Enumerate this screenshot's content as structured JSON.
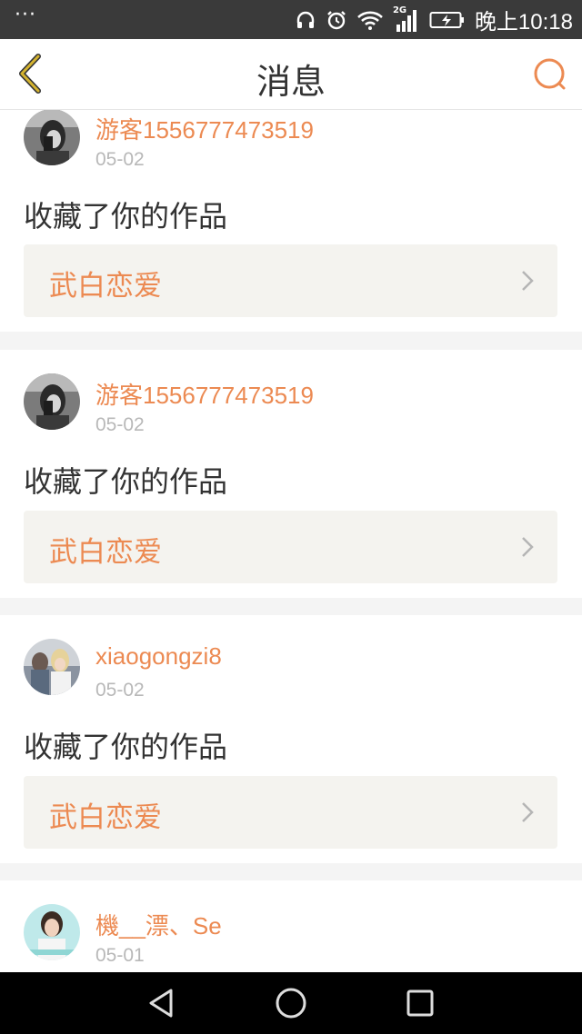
{
  "status_bar": {
    "dots": "···",
    "network": "2G",
    "time": "晚上10:18"
  },
  "header": {
    "title": "消息",
    "back_icon": "chevron-left-icon",
    "search_icon": "search-icon"
  },
  "colors": {
    "accent": "#ec8a52",
    "back_icon": "#c9a21a",
    "card_link_bg": "#f4f3ef"
  },
  "messages": [
    {
      "username": "游客1556777473519",
      "date": "05-02",
      "action": "收藏了你的作品",
      "work_title": "武白恋爱"
    },
    {
      "username": "游客1556777473519",
      "date": "05-02",
      "action": "收藏了你的作品",
      "work_title": "武白恋爱"
    },
    {
      "username": "xiaogongzi8",
      "date": "05-02",
      "action": "收藏了你的作品",
      "work_title": "武白恋爱"
    },
    {
      "username": "機__漂、Se",
      "date": "05-01"
    }
  ]
}
